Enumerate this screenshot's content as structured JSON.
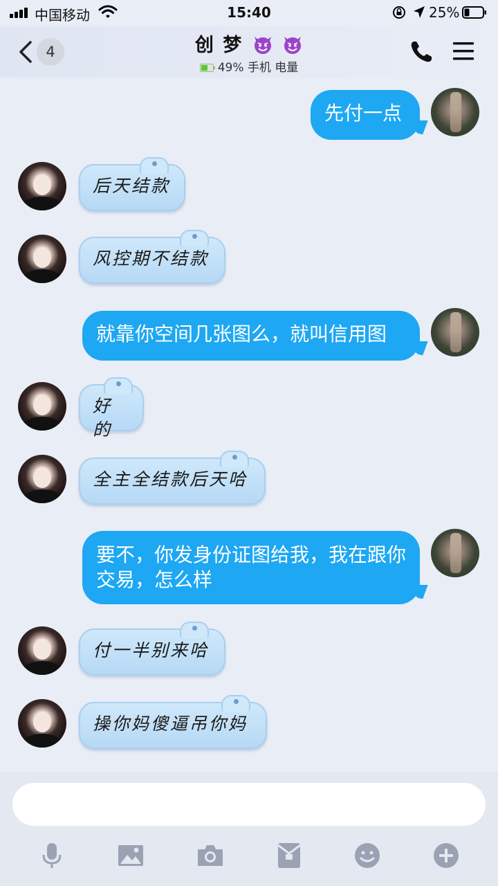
{
  "status_bar": {
    "carrier": "中国移动",
    "time": "15:40",
    "battery_percent": "25%"
  },
  "header": {
    "back_count": "4",
    "title": "创 梦",
    "title_emoji": "smiling-imp-emoji",
    "subtitle": "49% 手机 电量"
  },
  "messages": [
    {
      "sender": "me",
      "text": "先付一点"
    },
    {
      "sender": "contact",
      "text": "后天结款"
    },
    {
      "sender": "contact",
      "text": "风控期不结款"
    },
    {
      "sender": "me",
      "text": "就靠你空间几张图么，就叫信用图"
    },
    {
      "sender": "contact",
      "text": "好的"
    },
    {
      "sender": "contact",
      "text": "全主全结款后天哈"
    },
    {
      "sender": "me",
      "text": "要不，你发身份证图给我，我在跟你交易，怎么样"
    },
    {
      "sender": "contact",
      "text": "付一半别来哈"
    },
    {
      "sender": "contact",
      "text": "操你妈傻逼吊你妈"
    }
  ],
  "composer": {
    "input_value": "",
    "toolbar": [
      "microphone-icon",
      "image-icon",
      "camera-icon",
      "red-packet-icon",
      "emoji-icon",
      "plus-icon"
    ]
  },
  "colors": {
    "outgoing_bubble": "#1ea7f2",
    "incoming_bubble": "#c3e0f8",
    "background": "#e9edf6",
    "toolbar_icon": "#9aa2b3"
  }
}
